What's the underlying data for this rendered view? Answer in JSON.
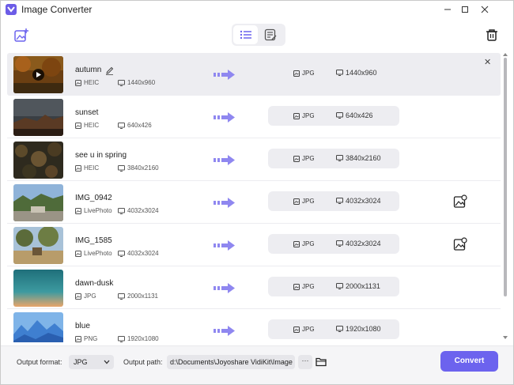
{
  "app": {
    "title": "Image Converter"
  },
  "colors": {
    "accent": "#6c63ee",
    "arrow": "#8f87f0"
  },
  "toolbar": {
    "add_icon": "add-image-icon",
    "views": [
      "list-view-icon",
      "detail-view-icon"
    ],
    "delete_icon": "trash-icon"
  },
  "files": [
    {
      "name": "autumn",
      "format": "HEIC",
      "resolution": "1440x960",
      "out_format": "JPG",
      "out_resolution": "1440x960"
    },
    {
      "name": "sunset",
      "format": "HEIC",
      "resolution": "640x426",
      "out_format": "JPG",
      "out_resolution": "640x426"
    },
    {
      "name": "see u in spring",
      "format": "HEIC",
      "resolution": "3840x2160",
      "out_format": "JPG",
      "out_resolution": "3840x2160"
    },
    {
      "name": "IMG_0942",
      "format": "LivePhoto",
      "resolution": "4032x3024",
      "out_format": "JPG",
      "out_resolution": "4032x3024"
    },
    {
      "name": "IMG_1585",
      "format": "LivePhoto",
      "resolution": "4032x3024",
      "out_format": "JPG",
      "out_resolution": "4032x3024"
    },
    {
      "name": "dawn-dusk",
      "format": "JPG",
      "resolution": "2000x1131",
      "out_format": "JPG",
      "out_resolution": "2000x1131"
    },
    {
      "name": "blue",
      "format": "PNG",
      "resolution": "1920x1080",
      "out_format": "JPG",
      "out_resolution": "1920x1080"
    }
  ],
  "footer": {
    "output_format_label": "Output format:",
    "output_format_value": "JPG",
    "output_path_label": "Output path:",
    "output_path_value": "d:\\Documents\\Joyoshare VidiKit\\Image",
    "more_label": "···",
    "convert_label": "Convert"
  }
}
